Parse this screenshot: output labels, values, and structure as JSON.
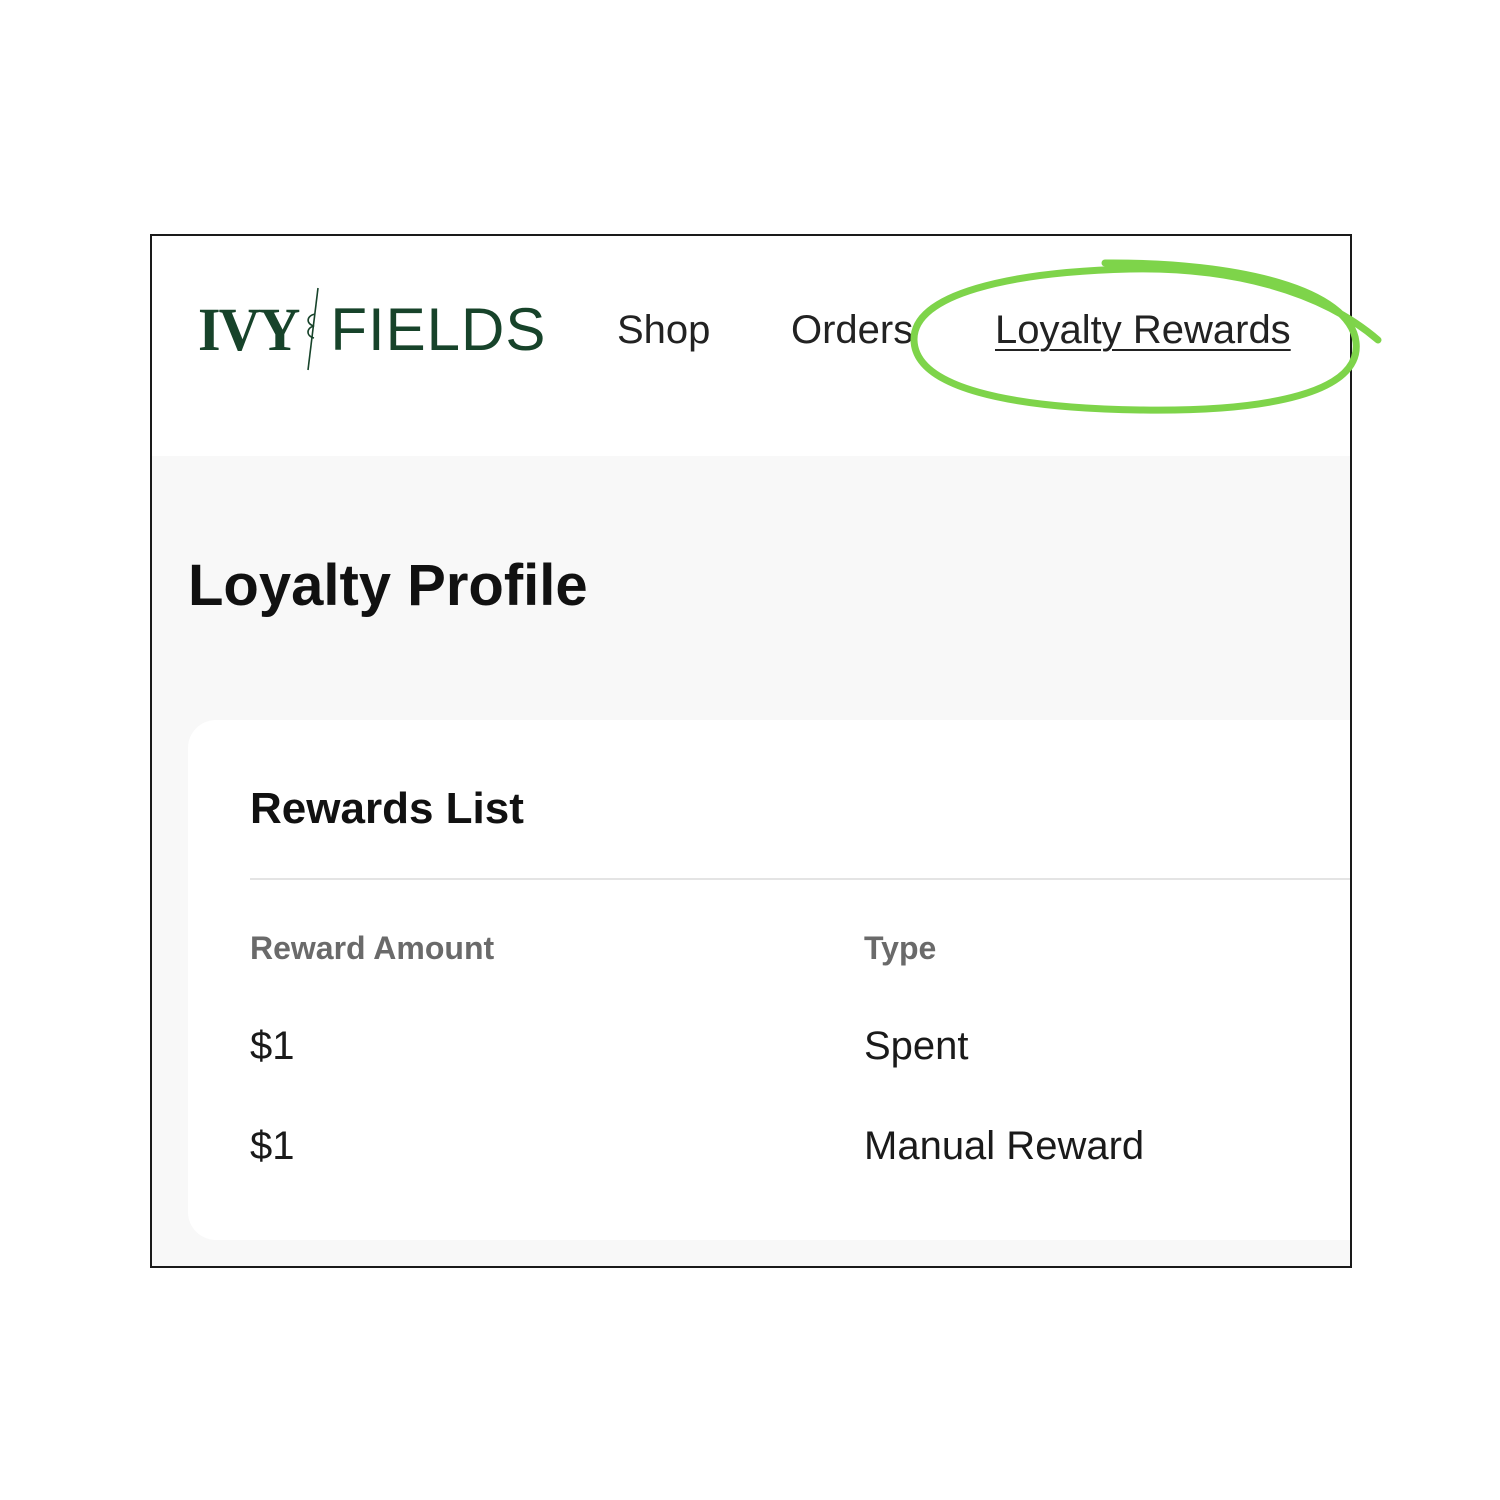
{
  "header": {
    "logo": {
      "word1": "IVY",
      "word2": "FIELDS",
      "color": "#17432a"
    },
    "nav": {
      "shop": "Shop",
      "orders": "Orders",
      "loyalty_rewards": "Loyalty Rewards"
    }
  },
  "main": {
    "page_title": "Loyalty Profile",
    "rewards_card": {
      "title": "Rewards List",
      "columns": [
        "Reward Amount",
        "Type"
      ],
      "rows": [
        [
          "$1",
          "Spent"
        ],
        [
          "$1",
          "Manual Reward"
        ]
      ]
    }
  },
  "annotation": {
    "highlight_color": "#7ed44a",
    "highlight_icon": "circle-highlight"
  }
}
